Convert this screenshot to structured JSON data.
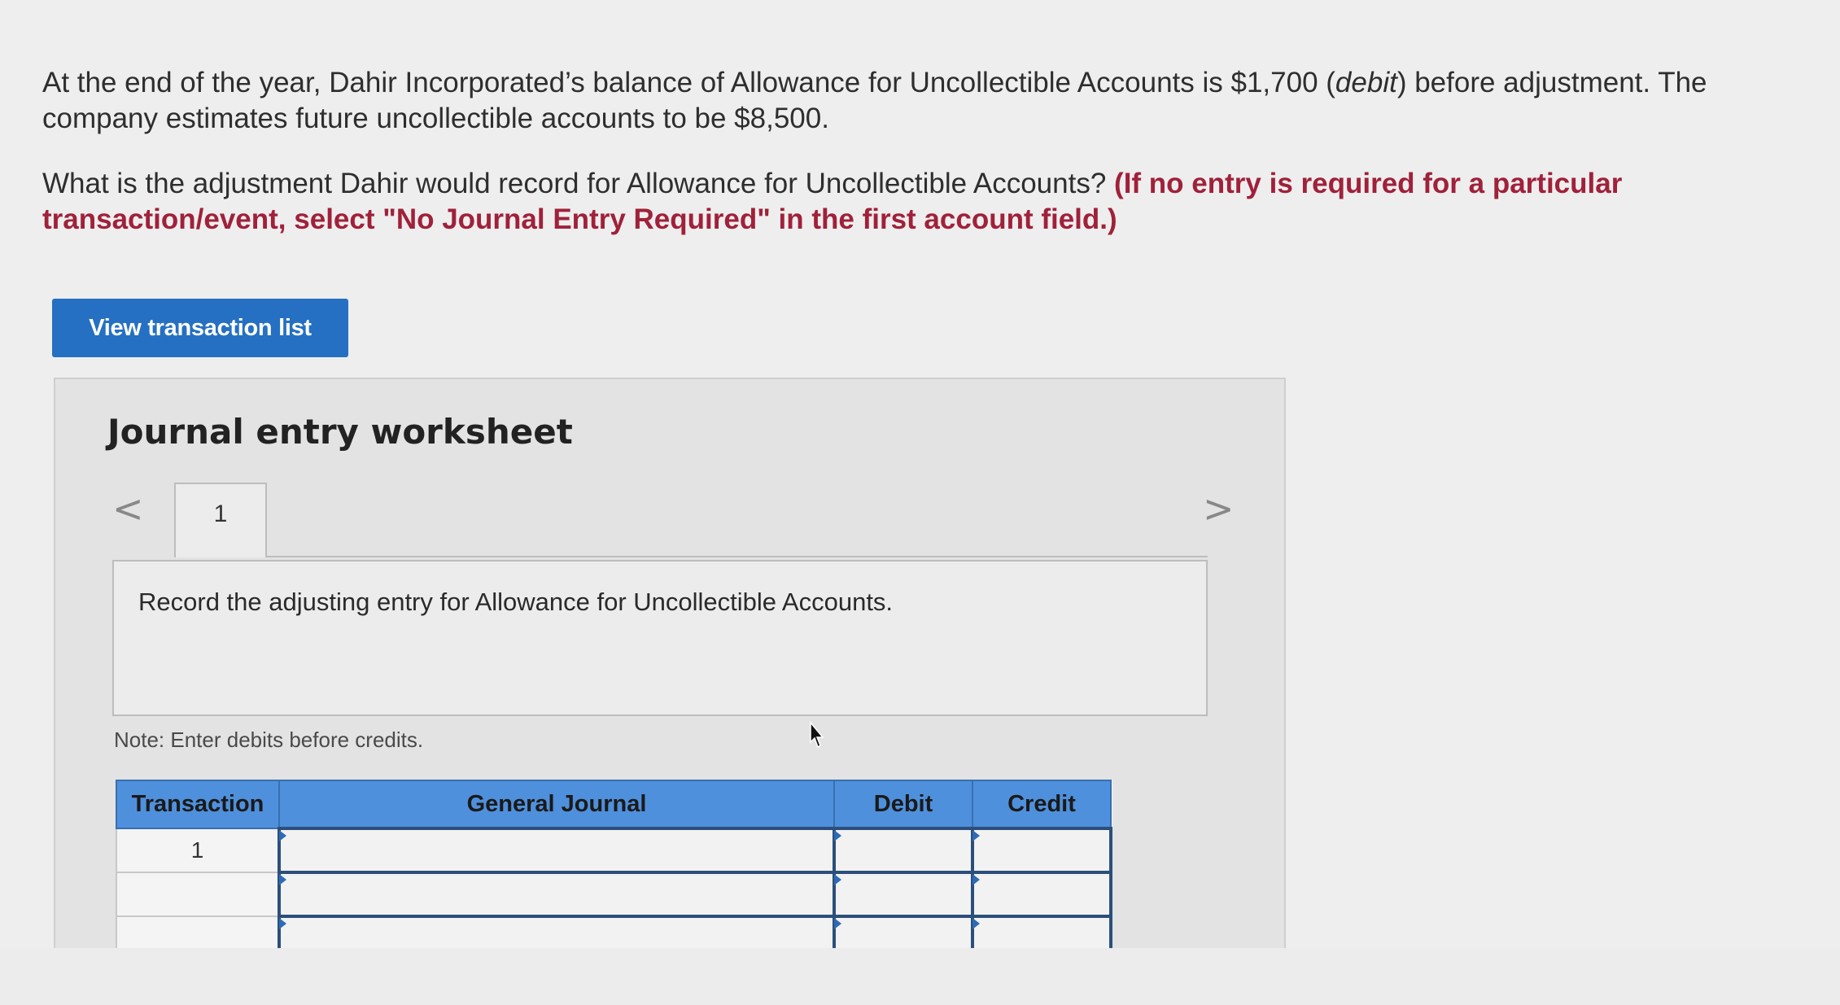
{
  "question": {
    "line1_pre": "At the end of the year, Dahir Incorporated’s balance of Allowance for Uncollectible Accounts is $1,700 (",
    "line1_em": "debit",
    "line1_post": ") before adjustment. The company estimates future uncollectible accounts to be $8,500.",
    "line2": "What is the adjustment Dahir would record for Allowance for Uncollectible Accounts?",
    "instruction": "(If no entry is required for a particular transaction/event, select \"No Journal Entry Required\" in the first account field.)"
  },
  "button": {
    "view_transactions": "View transaction list"
  },
  "worksheet": {
    "title": "Journal entry worksheet",
    "tab_label": "1",
    "record_text": "Record the adjusting entry for Allowance for Uncollectible Accounts.",
    "note": "Note: Enter debits before credits."
  },
  "table": {
    "headers": [
      "Transaction",
      "General Journal",
      "Debit",
      "Credit"
    ],
    "rows": [
      {
        "transaction": "1",
        "account": "",
        "debit": "",
        "credit": ""
      },
      {
        "transaction": "",
        "account": "",
        "debit": "",
        "credit": ""
      },
      {
        "transaction": "",
        "account": "",
        "debit": "",
        "credit": ""
      }
    ]
  },
  "icons": {
    "prev": "chevron-left-icon",
    "next": "chevron-right-icon",
    "cursor": "mouse-pointer-icon"
  }
}
